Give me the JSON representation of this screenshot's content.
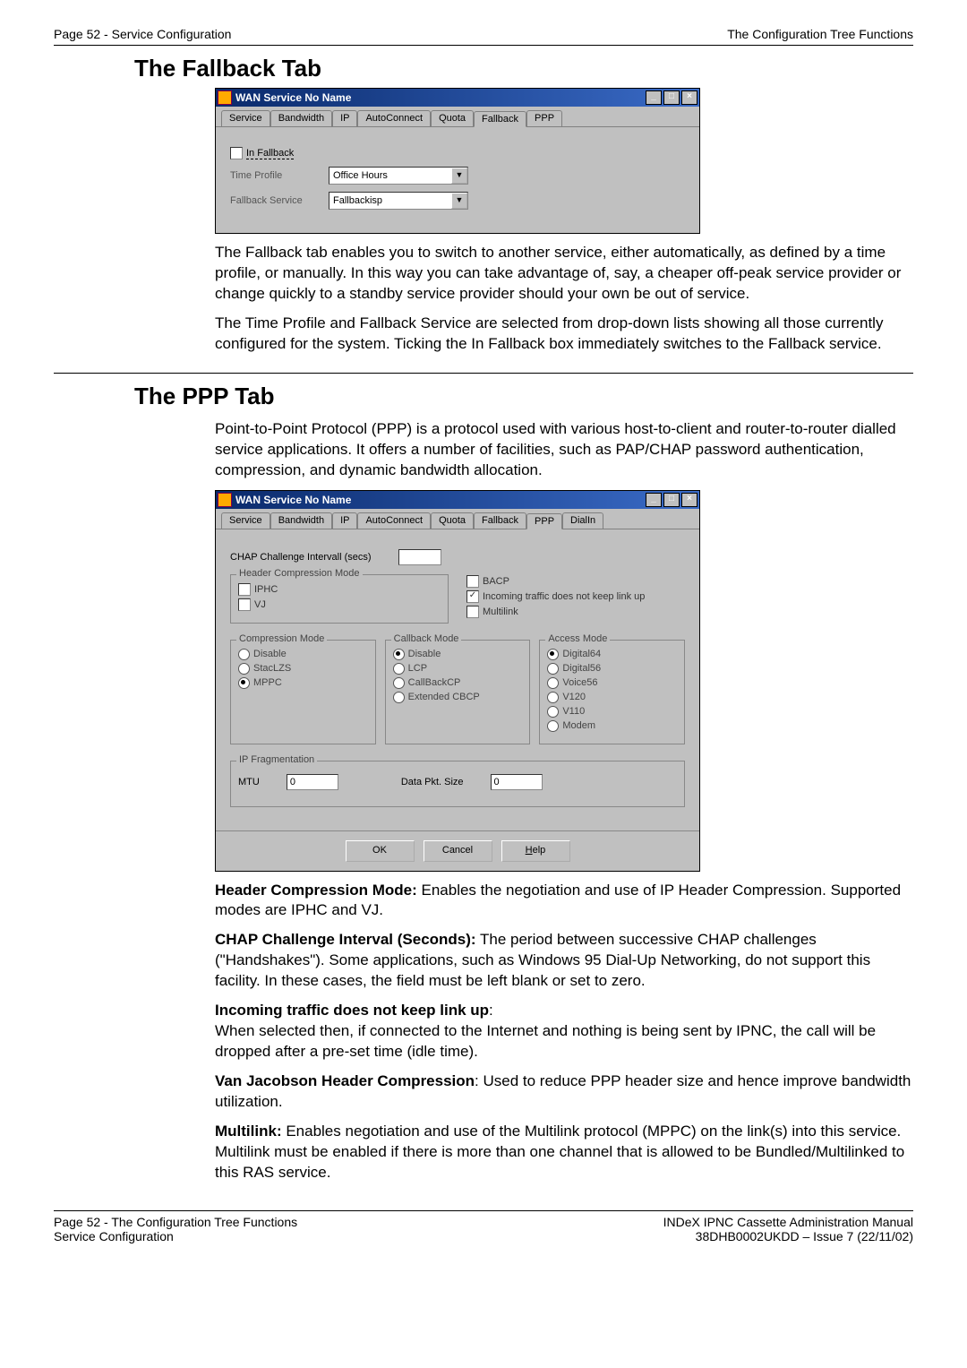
{
  "header": {
    "left": "Page 52 - Service Configuration",
    "right": "The Configuration Tree Functions"
  },
  "fallback": {
    "heading": "The Fallback Tab",
    "win_title": "WAN Service No Name",
    "tabs": [
      "Service",
      "Bandwidth",
      "IP",
      "AutoConnect",
      "Quota",
      "Fallback",
      "PPP"
    ],
    "active_tab": "Fallback",
    "in_fallback_label": "In Fallback",
    "time_profile_label": "Time Profile",
    "time_profile_value": "Office Hours",
    "fallback_service_label": "Fallback Service",
    "fallback_service_value": "Fallbackisp",
    "para1": "The Fallback tab enables you to switch to another service, either automatically, as defined by a time profile, or manually. In this way you can take advantage of, say, a cheaper off-peak service provider or change quickly to a standby service provider should your own be out of service.",
    "para2": "The Time Profile and Fallback Service are selected from drop-down lists showing all those currently configured for the system. Ticking the In Fallback box immediately switches to the Fallback service."
  },
  "ppp": {
    "heading": "The PPP Tab",
    "intro": "Point-to-Point Protocol (PPP) is a protocol used with various host-to-client and router-to-router dialled service applications. It offers a number of facilities, such as PAP/CHAP password authentication, compression, and dynamic bandwidth allocation.",
    "win_title": "WAN Service No Name",
    "tabs": [
      "Service",
      "Bandwidth",
      "IP",
      "AutoConnect",
      "Quota",
      "Fallback",
      "PPP",
      "DialIn"
    ],
    "active_tab": "PPP",
    "chap_label": "CHAP Challenge Intervall (secs)",
    "chap_value": "",
    "hc_legend": "Header Compression Mode",
    "hc_iphc": "IPHC",
    "hc_vj": "VJ",
    "bacp": "BACP",
    "incoming": "Incoming traffic does not keep link up",
    "multilink": "Multilink",
    "compression_legend": "Compression Mode",
    "compression_opts": [
      "Disable",
      "StacLZS",
      "MPPC"
    ],
    "compression_selected": "MPPC",
    "callback_legend": "Callback Mode",
    "callback_opts": [
      "Disable",
      "LCP",
      "CallBackCP",
      "Extended CBCP"
    ],
    "callback_selected": "Disable",
    "access_legend": "Access Mode",
    "access_opts": [
      "Digital64",
      "Digital56",
      "Voice56",
      "V120",
      "V110",
      "Modem"
    ],
    "access_selected": "Digital64",
    "ipfrag_legend": "IP Fragmentation",
    "mtu_label": "MTU",
    "mtu_value": "0",
    "datapkt_label": "Data Pkt. Size",
    "datapkt_value": "0",
    "ok_btn": "OK",
    "cancel_btn": "Cancel",
    "help_btn": "Help",
    "desc_hc_b": "Header Compression Mode:",
    "desc_hc": " Enables the negotiation and use of IP Header Compression. Supported modes are IPHC and VJ.",
    "desc_chap_b": "CHAP Challenge Interval (Seconds):",
    "desc_chap": " The period between successive CHAP challenges (\"Handshakes\"). Some applications, such as Windows 95 Dial-Up Networking, do not support this facility. In these cases, the field must be left blank or set to zero.",
    "desc_incoming_b": "Incoming traffic does not keep link up",
    "desc_incoming": "When selected then, if connected to the Internet and nothing is being sent by IPNC, the call will be dropped after a pre-set time (idle time).",
    "desc_vj_b": "Van Jacobson Header Compression",
    "desc_vj": ": Used to reduce PPP header size and hence improve bandwidth utilization.",
    "desc_multi_b": "Multilink:",
    "desc_multi": " Enables negotiation and use of the Multilink protocol (MPPC) on the link(s) into this service. Multilink must be enabled if there is more than one channel that is allowed to be Bundled/Multilinked to this RAS service."
  },
  "footer": {
    "left1": "Page 52 - The Configuration Tree Functions",
    "left2": "Service Configuration",
    "right1": "INDeX IPNC Cassette Administration Manual",
    "right2": "38DHB0002UKDD – Issue 7 (22/11/02)"
  }
}
